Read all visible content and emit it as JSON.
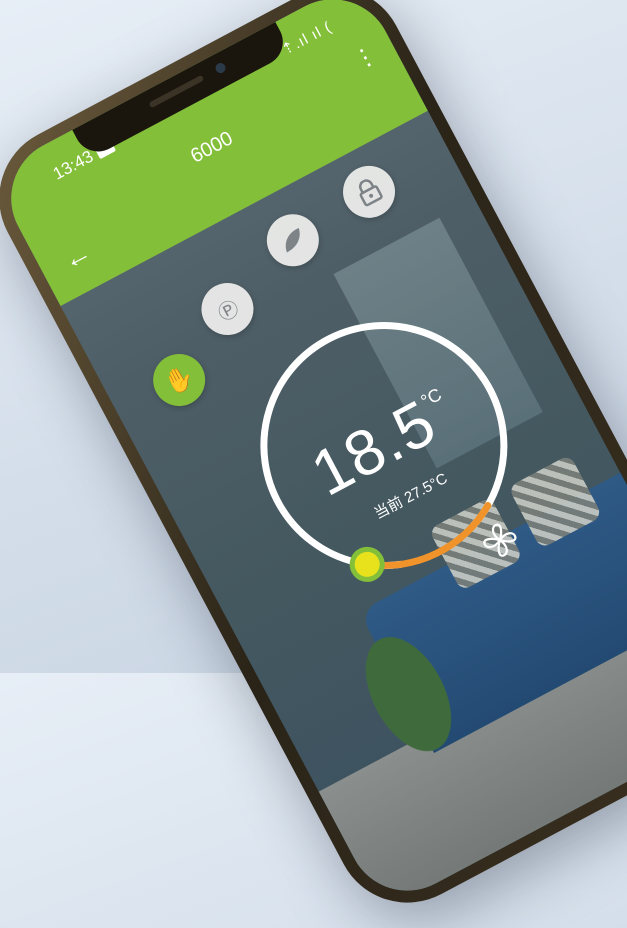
{
  "status_bar": {
    "time": "13:43",
    "signal": "⇡.ıl ıl ("
  },
  "app_bar": {
    "title": "6000"
  },
  "icons": {
    "back": "arrow-left",
    "more": "more-vertical",
    "lock": "lock",
    "eco": "leaf",
    "program": "program-house",
    "manual": "hand"
  },
  "modes": [
    {
      "name": "manual",
      "active": true
    },
    {
      "name": "program",
      "active": false
    },
    {
      "name": "eco",
      "active": false
    },
    {
      "name": "lock",
      "active": false
    }
  ],
  "thermostat": {
    "setpoint": "18.5",
    "unit": "°C",
    "current_label": "当前 27.5°C",
    "dial_fraction": 0.05
  },
  "colors": {
    "accent_green": "#84bf3a",
    "dial_orange": "#f0932a",
    "knob_yellow": "#e8e21c"
  }
}
